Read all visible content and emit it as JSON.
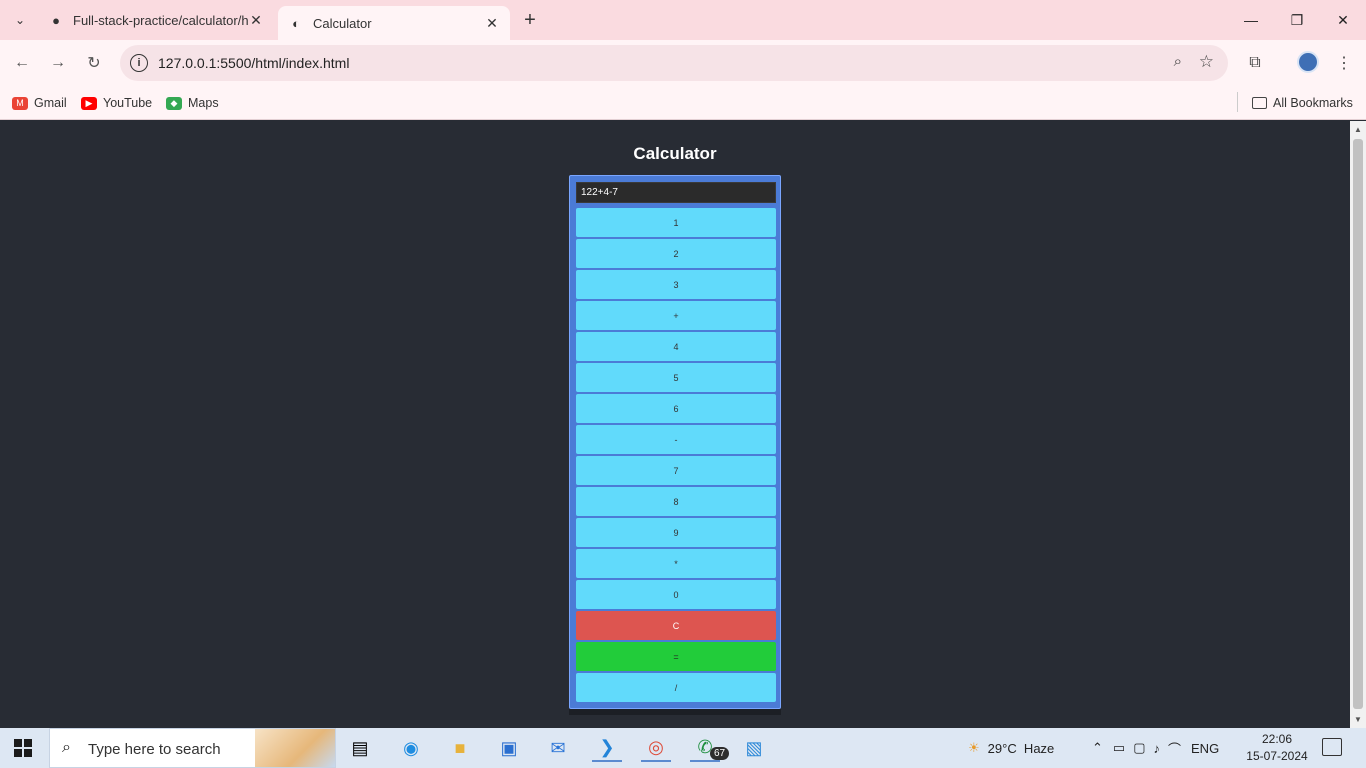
{
  "browser": {
    "tabs": [
      {
        "title": "Full-stack-practice/calculator/ht",
        "icon": "github-icon"
      },
      {
        "title": "Calculator",
        "icon": "globe-icon"
      }
    ],
    "url": "127.0.0.1:5500/html/index.html",
    "bookmarks": [
      "Gmail",
      "YouTube",
      "Maps"
    ],
    "all_bookmarks": "All Bookmarks"
  },
  "page": {
    "title": "Calculator",
    "display": "122+4-7",
    "keys": [
      "1",
      "2",
      "3",
      "+",
      "4",
      "5",
      "6",
      "-",
      "7",
      "8",
      "9",
      "*",
      "0",
      "C",
      "=",
      "/"
    ]
  },
  "taskbar": {
    "search_placeholder": "Type here to search",
    "whatsapp_badge": "67",
    "weather": "29°C  Haze",
    "language": "ENG",
    "time": "22:06",
    "date": "15-07-2024"
  },
  "colors": {
    "page_bg": "#282c34",
    "key": "#61dafb",
    "clear_key": "#dd5550",
    "equals_key": "#22cc3a",
    "calc_frame": "#4b7bd6"
  }
}
